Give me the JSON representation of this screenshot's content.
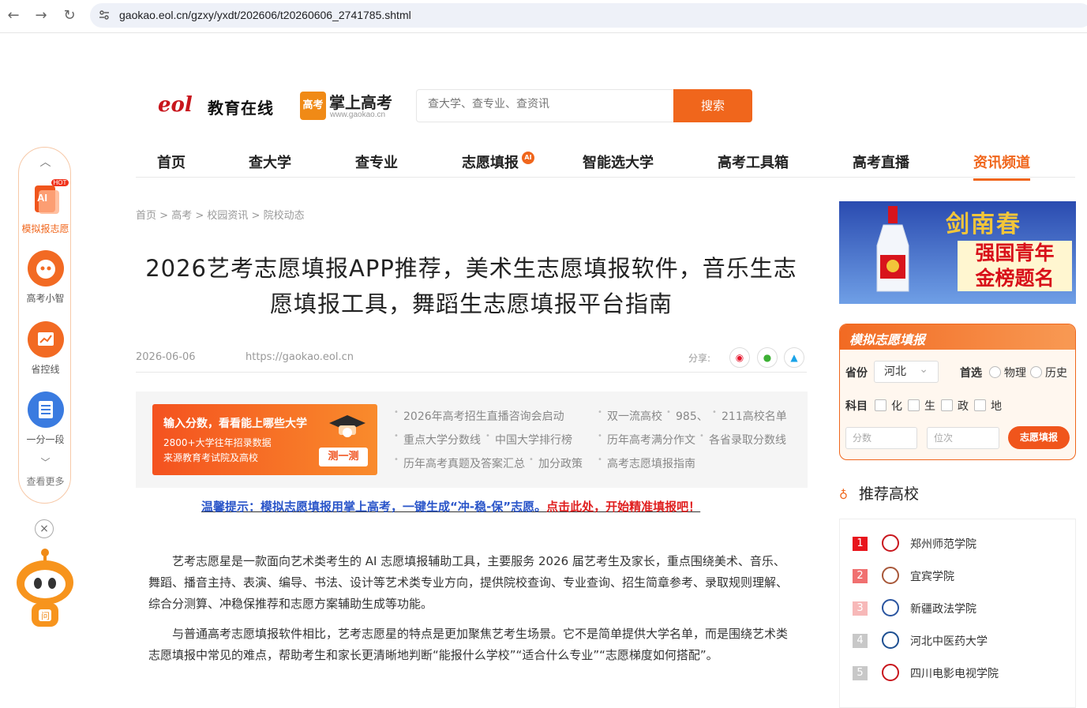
{
  "browser": {
    "url": "gaokao.eol.cn/gzxy/yxdt/202606/t20260606_2741785.shtml"
  },
  "header": {
    "eol_mark": "eol",
    "eol_name": "教育在线",
    "gk_badge": "高考",
    "gk_name": "掌上高考",
    "gk_domain": "www.gaokao.cn",
    "search_placeholder": "查大学、查专业、查资讯",
    "search_button": "搜索"
  },
  "nav": {
    "items": [
      "首页",
      "查大学",
      "查专业",
      "志愿填报",
      "智能选大学",
      "高考工具箱",
      "高考直播",
      "资讯频道"
    ],
    "ai_badge": "AI"
  },
  "sidebar": {
    "items": [
      "模拟报志愿",
      "高考小智",
      "省控线",
      "一分一段"
    ],
    "hot_badge": "HOT",
    "more": "查看更多"
  },
  "breadcrumb": [
    "首页",
    "高考",
    "校园资讯",
    "院校动态"
  ],
  "article": {
    "title": "2026艺考志愿填报APP推荐，美术生志愿填报软件，音乐生志愿填报工具，舞蹈生志愿填报平台指南",
    "date": "2026-06-06",
    "source": "https://gaokao.eol.cn",
    "share_label": "分享:",
    "paragraphs": [
      "艺考志愿星是一款面向艺术类考生的 AI 志愿填报辅助工具，主要服务 2026 届艺考生及家长，重点围绕美术、音乐、舞蹈、播音主持、表演、编导、书法、设计等艺术类专业方向，提供院校查询、专业查询、招生简章参考、录取规则理解、综合分测算、冲稳保推荐和志愿方案辅助生成等功能。",
      "与普通高考志愿填报软件相比，艺考志愿星的特点是更加聚焦艺考生场景。它不是简单提供大学名单，而是围绕艺术类志愿填报中常见的难点，帮助考生和家长更清晰地判断“能报什么学校”“适合什么专业”“志愿梯度如何搭配”。"
    ]
  },
  "promo": {
    "banner_title": "输入分数，看看能上哪些大学",
    "banner_line1": "2800+大学往年招录数据",
    "banner_line2": "来源教育考试院及高校",
    "banner_button": "测一测",
    "links": [
      [
        "2026年高考招生直播咨询会启动",
        "双一流高校",
        "985、",
        "211高校名单"
      ],
      [
        "重点大学分数线",
        "中国大学排行榜",
        "历年高考满分作文",
        "各省录取分数线"
      ],
      [
        "历年高考真题及答案汇总",
        "加分政策",
        "高考志愿填报指南"
      ]
    ]
  },
  "tip": {
    "blue": "温馨提示：模拟志愿填报用掌上高考，一键生成“冲-稳-保”志愿。",
    "red": "点击此处，开始精准填报吧！"
  },
  "ad": {
    "brand": "剑南春",
    "slogan1": "强国青年",
    "slogan2": "金榜题名"
  },
  "mock": {
    "title": "模拟志愿填报",
    "province_label": "省份",
    "province_value": "河北",
    "first_label": "首选",
    "first_options": [
      "物理",
      "历史"
    ],
    "subject_label": "科目",
    "subjects": [
      "化",
      "生",
      "政",
      "地"
    ],
    "score_placeholder": "分数",
    "rank_placeholder": "位次",
    "submit": "志愿填报"
  },
  "recommend": {
    "title": "推荐高校",
    "schools": [
      {
        "rank": "1",
        "name": "郑州师范学院",
        "color": "#e8141b"
      },
      {
        "rank": "2",
        "name": "宜宾学院",
        "color": "#f07070"
      },
      {
        "rank": "3",
        "name": "新疆政法学院",
        "color": "#f7b8b8"
      },
      {
        "rank": "4",
        "name": "河北中医药大学",
        "color": "#c8c8c8"
      },
      {
        "rank": "5",
        "name": "四川电影电视学院",
        "color": "#c8c8c8"
      }
    ]
  }
}
